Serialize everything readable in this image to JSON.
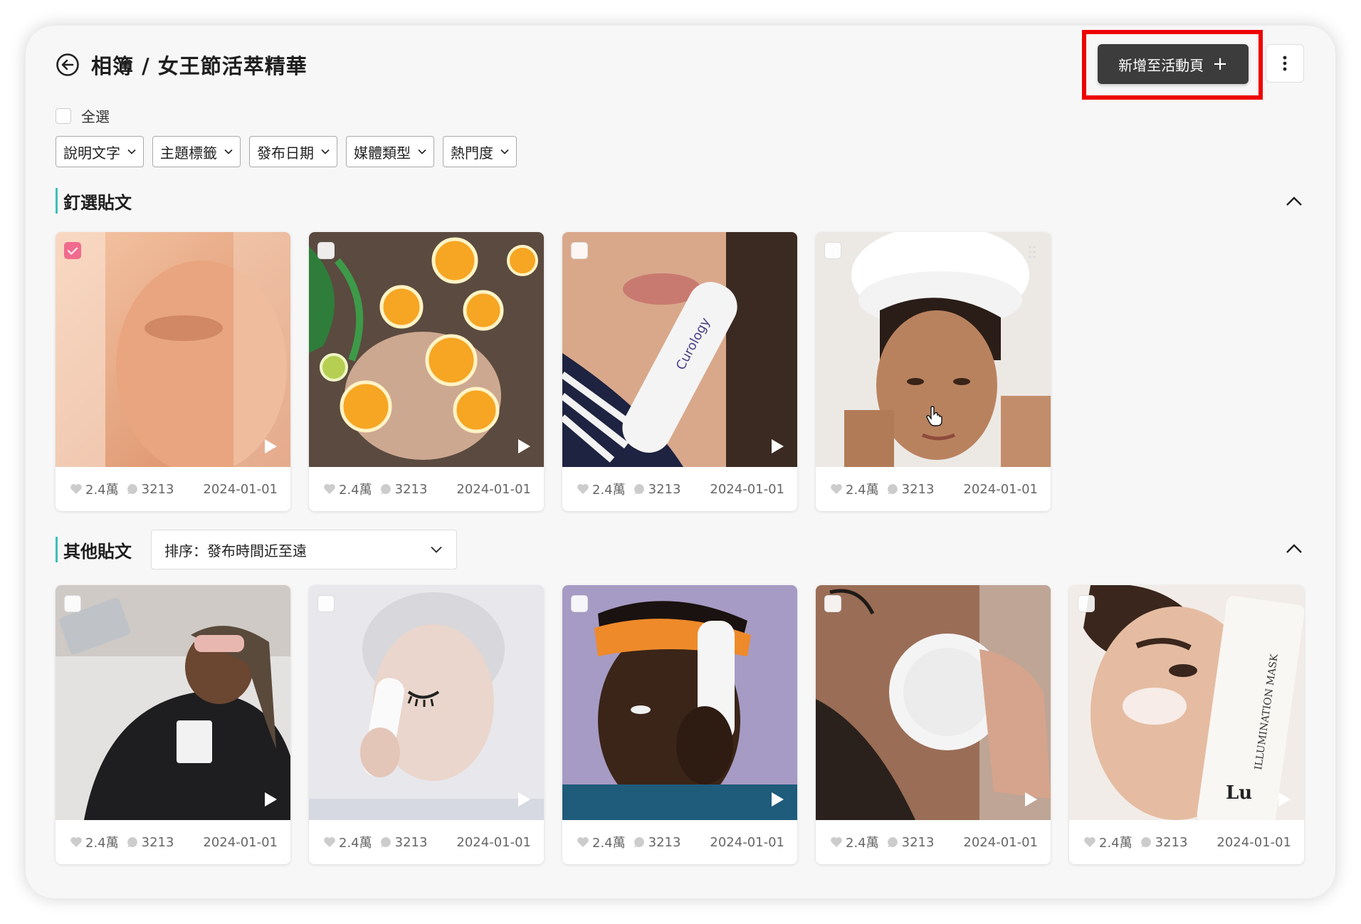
{
  "header": {
    "breadcrumb": "相簿 / 女王節活萃精華"
  },
  "toolbar": {
    "add_label": "新增至活動頁"
  },
  "select_all": {
    "label": "全選"
  },
  "filters": [
    "說明文字",
    "主題標籤",
    "發布日期",
    "媒體類型",
    "熱門度"
  ],
  "pinned": {
    "title": "釘選貼文",
    "posts": [
      {
        "likes": "2.4萬",
        "comments": "3213",
        "date": "2024-01-01",
        "checked": true,
        "media": "video"
      },
      {
        "likes": "2.4萬",
        "comments": "3213",
        "date": "2024-01-01",
        "checked": false,
        "media": "video"
      },
      {
        "likes": "2.4萬",
        "comments": "3213",
        "date": "2024-01-01",
        "checked": false,
        "media": "video"
      },
      {
        "likes": "2.4萬",
        "comments": "3213",
        "date": "2024-01-01",
        "checked": false,
        "media": "image"
      }
    ]
  },
  "others": {
    "title": "其他貼文",
    "sort_label": "排序：發布時間近至遠",
    "posts": [
      {
        "likes": "2.4萬",
        "comments": "3213",
        "date": "2024-01-01",
        "checked": false,
        "media": "video"
      },
      {
        "likes": "2.4萬",
        "comments": "3213",
        "date": "2024-01-01",
        "checked": false,
        "media": "video"
      },
      {
        "likes": "2.4萬",
        "comments": "3213",
        "date": "2024-01-01",
        "checked": false,
        "media": "video"
      },
      {
        "likes": "2.4萬",
        "comments": "3213",
        "date": "2024-01-01",
        "checked": false,
        "media": "video"
      },
      {
        "likes": "2.4萬",
        "comments": "3213",
        "date": "2024-01-01",
        "checked": false,
        "media": "video"
      }
    ]
  },
  "colors": {
    "accent": "#3fbfb8",
    "checked": "#f06b8e",
    "primary_button": "#3c3c3c",
    "highlight": "#ee0000"
  }
}
